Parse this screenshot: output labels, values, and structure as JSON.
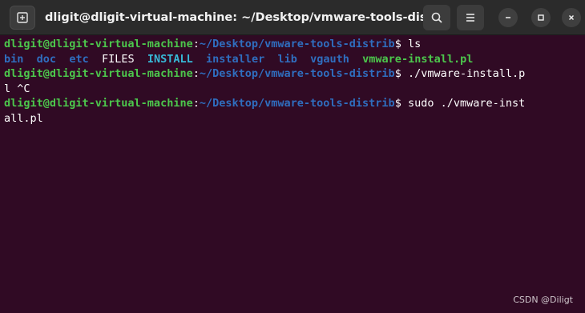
{
  "window": {
    "title": "dligit@dligit-virtual-machine: ~/Desktop/vmware-tools-distrib"
  },
  "terminal": {
    "prompt_user": "dligit@dligit-virtual-machine",
    "prompt_colon": ":",
    "prompt_path": "~/Desktop/vmware-tools-distrib",
    "prompt_symbol": "$ ",
    "cmd1": "ls",
    "ls_output": {
      "bin": "bin",
      "doc": "doc",
      "etc": "etc",
      "FILES": "FILES",
      "INSTALL": "INSTALL",
      "installer": "installer",
      "lib": "lib",
      "vgauth": "vgauth",
      "vmware_install": "vmware-install.pl"
    },
    "cmd2": "./vmware-install.p",
    "cmd2_wrap": "l ^C",
    "cmd3": "sudo ./vmware-inst",
    "cmd3_wrap": "all.pl"
  },
  "watermark": "CSDN @Diligt",
  "icons": {
    "new_tab": "new-tab-icon",
    "search": "search-icon",
    "menu": "hamburger-menu-icon",
    "minimize": "minimize-icon",
    "maximize": "maximize-icon",
    "close": "close-icon"
  },
  "colors": {
    "background": "#300a24",
    "titlebar": "#2b2b2b",
    "prompt_user": "#4cc74c",
    "prompt_path": "#2f6ebf",
    "text": "#ffffff"
  }
}
